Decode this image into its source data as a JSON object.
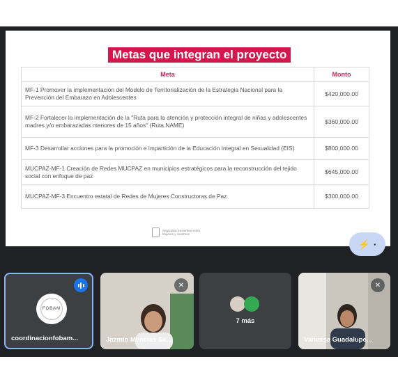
{
  "slide": {
    "title": "Metas que integran el proyecto",
    "table": {
      "headers": {
        "meta": "Meta",
        "monto": "Monto"
      },
      "rows": [
        {
          "meta": "MF-1 Promover la implementación del Modelo de Territorialización de la Estrategia Nacional para la Prevención del Embarazo en Adolescentes",
          "monto": "$420,000.00"
        },
        {
          "meta": "MF-2 Fortalecer la implementación de la \"Ruta para la atención y protección integral de niñas y adolescentes madres y/o embarazadas menores de 15 años\" (Ruta NAME)",
          "monto": "$360,000.00"
        },
        {
          "meta": "MF-3 Desarrollar acciones para la promoción e impartición de la Educación Integral en Sexualidad (EIS)",
          "monto": "$800,000.00"
        },
        {
          "meta": "MUCPAZ-MF-1 Creación de Redes MUCPAZ en municipios estratégicos para la reconstrucción del tejido social con enfoque de paz",
          "monto": "$645,000.00"
        },
        {
          "meta": "MUCPAZ-MF-3 Encuentro estatal de Redes de Mujeres Constructoras de Paz",
          "monto": "$300,000.00"
        }
      ]
    },
    "logo_text": "Seguridad Sustantiva entre Mujeres y Hombres"
  },
  "fab": {
    "icon": "lightning-icon",
    "label": "·"
  },
  "participants": [
    {
      "name": "coordinacionfobam...",
      "avatar_text": "FOBAM",
      "speaking": true
    },
    {
      "name": "Jazmín Mencías Sa...",
      "muted": true
    },
    {
      "name": "7 más"
    },
    {
      "name": "Vanessa Guadalupe...",
      "muted": true
    }
  ],
  "colors": {
    "title_bg": "#d4184d",
    "header_text": "#e0245e",
    "meet_bg": "#202124",
    "tile_bg": "#3c4043",
    "accent": "#1a73e8"
  }
}
